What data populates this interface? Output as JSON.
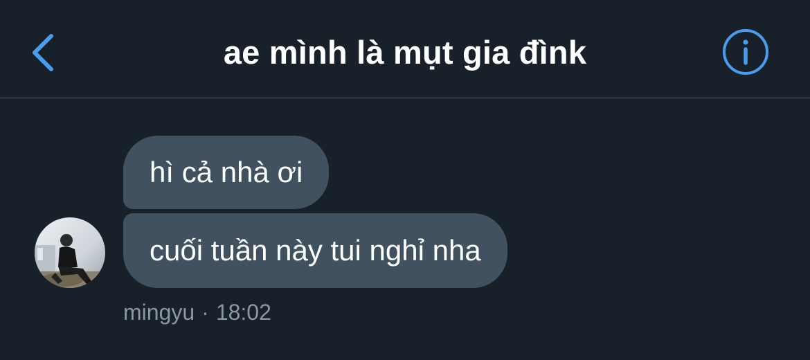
{
  "header": {
    "title": "ae mình là mụt gia đìnk",
    "back_icon": "chevron-left-icon",
    "info_icon": "info-icon",
    "accent_color": "#4a9ded"
  },
  "messages": [
    {
      "text": "hì cả nhà ơi"
    },
    {
      "text": "cuối tuần này tui nghỉ nha"
    }
  ],
  "meta": {
    "sender": "mingyu",
    "separator": "·",
    "time": "18:02"
  },
  "colors": {
    "background": "#18202a",
    "bubble": "#425160",
    "divider": "#4c5864",
    "meta_text": "#8b97a3"
  }
}
